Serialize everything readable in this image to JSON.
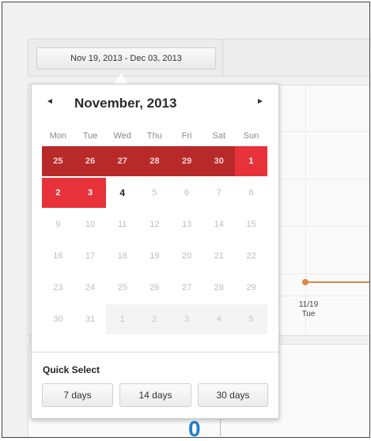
{
  "toolbar": {
    "date_range": "Nov 19, 2013 - Dec 03, 2013"
  },
  "chart": {
    "x_label_date": "11/19",
    "x_label_day": "Tue",
    "line_color": "#d9894a"
  },
  "lower_panel": {
    "count": "0"
  },
  "calendar": {
    "month_title": "November, 2013",
    "prev_icon": "◄",
    "next_icon": "►",
    "weekdays": [
      "Mon",
      "Tue",
      "Wed",
      "Thu",
      "Fri",
      "Sat",
      "Sun"
    ],
    "range_color": "#b82a2a",
    "selected_color": "#e8323a",
    "weeks": [
      [
        {
          "d": "25",
          "s": "range"
        },
        {
          "d": "26",
          "s": "range"
        },
        {
          "d": "27",
          "s": "range"
        },
        {
          "d": "28",
          "s": "range"
        },
        {
          "d": "29",
          "s": "range"
        },
        {
          "d": "30",
          "s": "range"
        },
        {
          "d": "1",
          "s": "selected"
        }
      ],
      [
        {
          "d": "2",
          "s": "selected"
        },
        {
          "d": "3",
          "s": "selected"
        },
        {
          "d": "4",
          "s": "available"
        },
        {
          "d": "5",
          "s": "disabled"
        },
        {
          "d": "6",
          "s": "disabled"
        },
        {
          "d": "7",
          "s": "disabled"
        },
        {
          "d": "8",
          "s": "disabled"
        }
      ],
      [
        {
          "d": "9",
          "s": "disabled"
        },
        {
          "d": "10",
          "s": "disabled"
        },
        {
          "d": "11",
          "s": "disabled"
        },
        {
          "d": "12",
          "s": "disabled"
        },
        {
          "d": "13",
          "s": "disabled"
        },
        {
          "d": "14",
          "s": "disabled"
        },
        {
          "d": "15",
          "s": "disabled"
        }
      ],
      [
        {
          "d": "16",
          "s": "disabled"
        },
        {
          "d": "17",
          "s": "disabled"
        },
        {
          "d": "18",
          "s": "disabled"
        },
        {
          "d": "19",
          "s": "disabled"
        },
        {
          "d": "20",
          "s": "disabled"
        },
        {
          "d": "21",
          "s": "disabled"
        },
        {
          "d": "22",
          "s": "disabled"
        }
      ],
      [
        {
          "d": "23",
          "s": "disabled"
        },
        {
          "d": "24",
          "s": "disabled"
        },
        {
          "d": "25",
          "s": "disabled"
        },
        {
          "d": "26",
          "s": "disabled"
        },
        {
          "d": "27",
          "s": "disabled"
        },
        {
          "d": "28",
          "s": "disabled"
        },
        {
          "d": "29",
          "s": "disabled"
        }
      ],
      [
        {
          "d": "30",
          "s": "disabled"
        },
        {
          "d": "31",
          "s": "disabled"
        },
        {
          "d": "1",
          "s": "other-month"
        },
        {
          "d": "2",
          "s": "other-month"
        },
        {
          "d": "3",
          "s": "other-month"
        },
        {
          "d": "4",
          "s": "other-month"
        },
        {
          "d": "5",
          "s": "other-month"
        }
      ]
    ]
  },
  "quick_select": {
    "title": "Quick Select",
    "buttons": [
      "7 days",
      "14 days",
      "30 days"
    ]
  }
}
